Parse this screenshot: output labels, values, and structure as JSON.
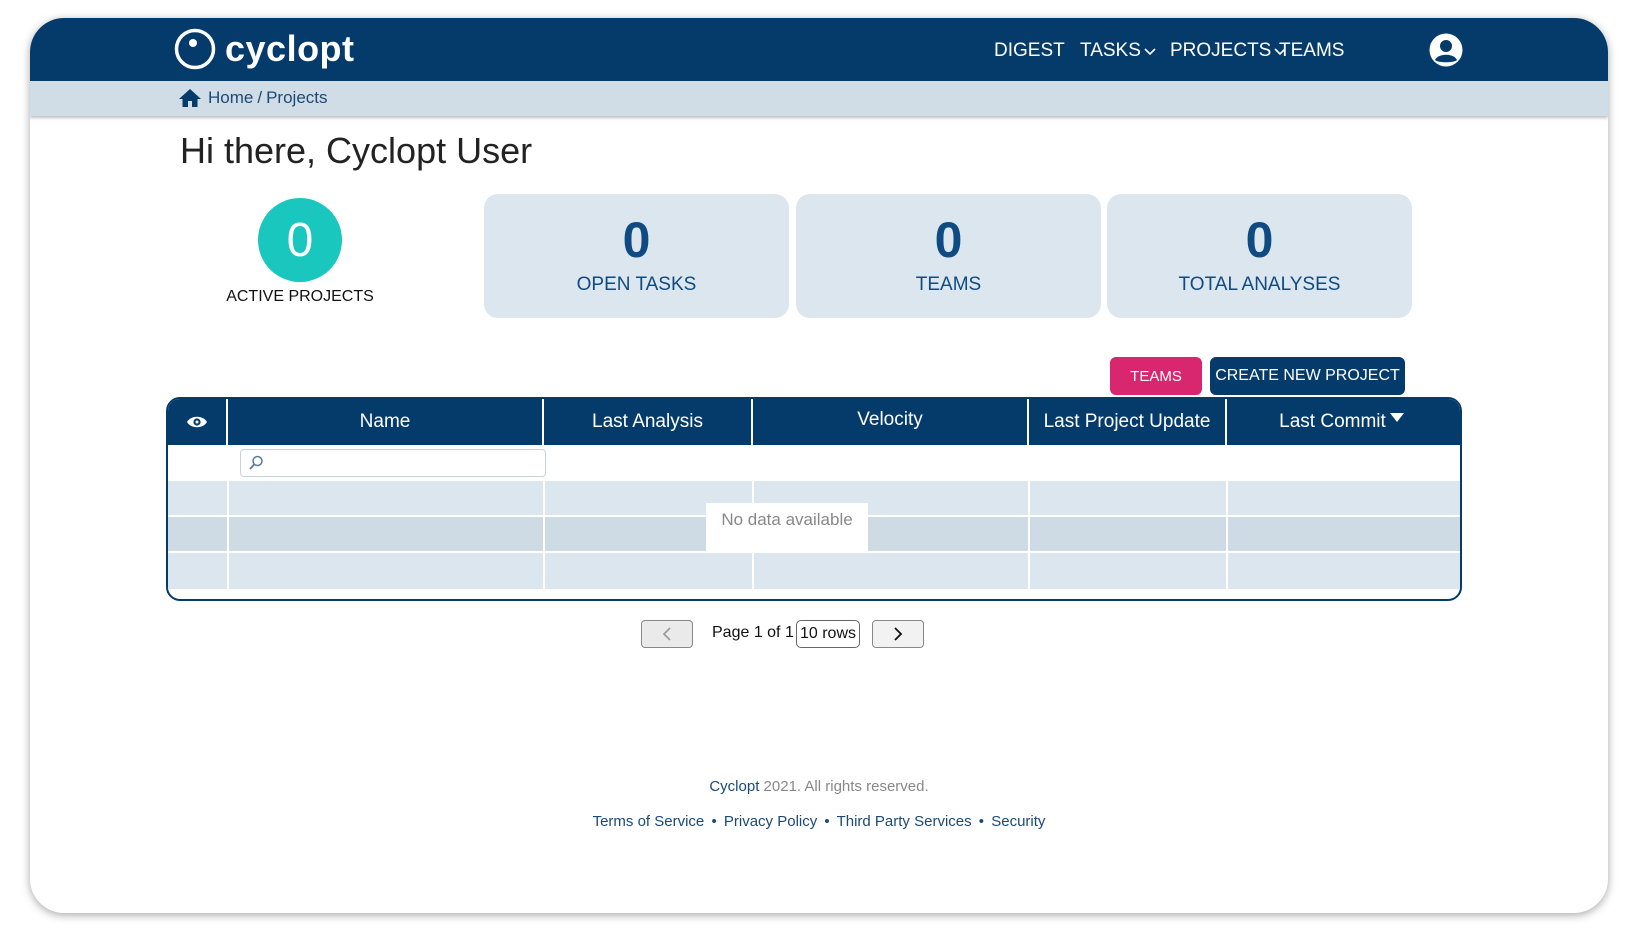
{
  "header": {
    "logo_text": "cyclopt",
    "nav": [
      {
        "label": "DIGEST"
      },
      {
        "label": "TASKS"
      },
      {
        "label": "PROJECTS"
      },
      {
        "label": "TEAMS"
      }
    ]
  },
  "breadcrumb": {
    "home": "Home",
    "separator": "/",
    "current": "Projects"
  },
  "greeting": "Hi there, Cyclopt User",
  "active_projects": {
    "value": "0",
    "label": "ACTIVE PROJECTS"
  },
  "stats": [
    {
      "value": "0",
      "label": "OPEN TASKS"
    },
    {
      "value": "0",
      "label": "TEAMS"
    },
    {
      "value": "0",
      "label": "TOTAL ANALYSES"
    }
  ],
  "actions": {
    "teams": "TEAMS",
    "create": "CREATE NEW PROJECT"
  },
  "table": {
    "columns": [
      "Name",
      "Last Analysis",
      "Velocity",
      "Last Project Update",
      "Last Commit"
    ],
    "empty_text": "No data available",
    "search_placeholder": ""
  },
  "pagination": {
    "page_text": "Page 1 of 1",
    "rows": "10 rows"
  },
  "footer": {
    "brand": "Cyclopt",
    "copyright": " 2021. All rights reserved.",
    "links": [
      "Terms of Service",
      "Privacy Policy",
      "Third Party Services",
      "Security"
    ],
    "separator": "•"
  },
  "colors": {
    "primary": "#053b6b",
    "accent_pink": "#d8276e",
    "teal": "#19c7bf",
    "card_bg": "#dce6ee"
  }
}
